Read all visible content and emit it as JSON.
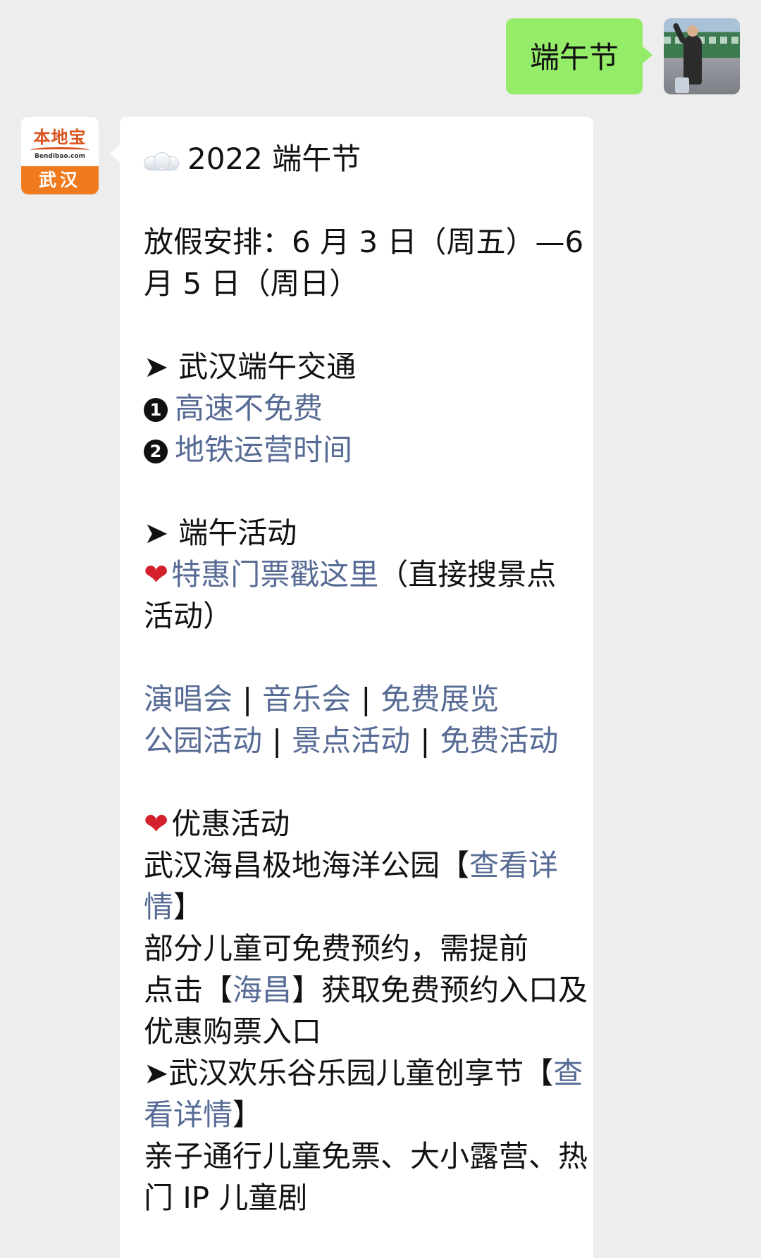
{
  "user_message": {
    "text": "端午节"
  },
  "bot": {
    "logo": {
      "brand": "本地宝",
      "domain": "Bendibao.com",
      "city": "武汉"
    },
    "message": {
      "title": "2022 端午节",
      "holiday_line1": "放假安排：6 月 3 日（周五）—6",
      "holiday_line2": "月 5 日（周日）",
      "arrow_glyph": "➤",
      "traffic_heading": "武汉端午交通",
      "traffic_items": [
        {
          "num": "1",
          "label": "高速不免费"
        },
        {
          "num": "2",
          "label": "地铁运营时间"
        }
      ],
      "activities_heading": "端午活动",
      "heart_glyph": "❤",
      "tickets_link": "特惠门票戳这里",
      "tickets_note_part1": "（直接搜景点",
      "tickets_note_part2": "活动）",
      "separator": "|",
      "category_links_row1": [
        "演唱会",
        "音乐会",
        "免费展览"
      ],
      "category_links_row2": [
        "公园活动",
        "景点活动",
        "免费活动"
      ],
      "discount_heading": "优惠活动",
      "haichang_name": "武汉海昌极地海洋公园【",
      "haichang_detail_link_part1": "查看详",
      "haichang_detail_link_part2": "情",
      "close_bracket": "】",
      "haichang_desc_line1": "部分儿童可免费预约，需提前",
      "haichang_desc_prefix": "点击【",
      "haichang_link": "海昌",
      "haichang_desc_suffix": "】获取免费预约入口及",
      "haichang_desc_line3": "优惠购票入口",
      "happyvalley_name": "武汉欢乐谷乐园儿童创享节【",
      "happyvalley_link_part1": "查",
      "happyvalley_link_part2": "看详情",
      "happyvalley_desc_line1": "亲子通行儿童免票、大小露营、热",
      "happyvalley_desc_line2": "门 IP 儿童剧"
    }
  }
}
